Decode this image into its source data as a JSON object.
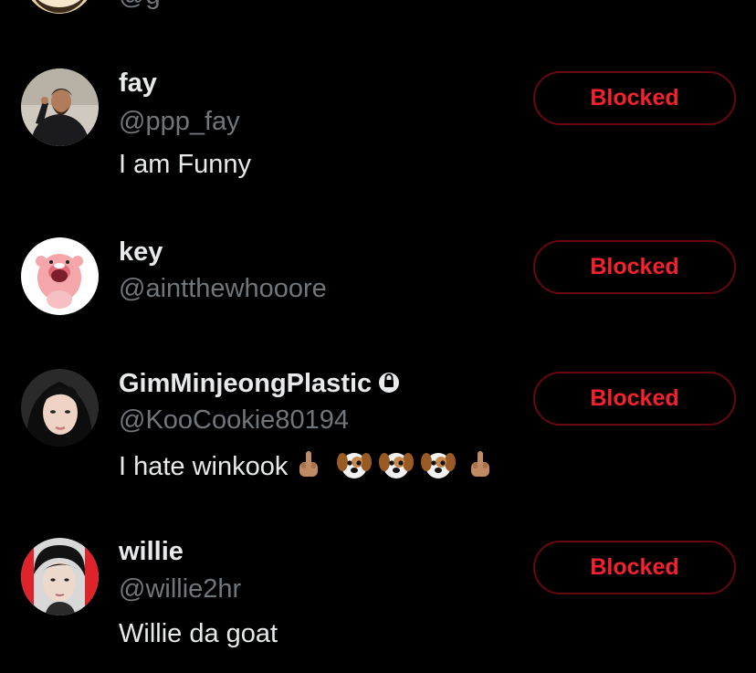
{
  "users": [
    {
      "name": "fay",
      "handle": "@ppp_fay",
      "bio": "I am Funny",
      "button_label": "Blocked"
    },
    {
      "name": "key",
      "handle": "@aintthewhooore",
      "bio": "",
      "button_label": "Blocked"
    },
    {
      "name": "GimMinjeongPlastic",
      "handle": "@KooCookie80194",
      "bio": "I hate winkook",
      "protected": true,
      "bio_emojis": [
        "middle-finger-emoji",
        "dog-face-emoji",
        "dog-face-emoji",
        "dog-face-emoji",
        "middle-finger-emoji"
      ],
      "button_label": "Blocked"
    },
    {
      "name": "willie",
      "handle": "@willie2hr",
      "bio": "Willie da goat",
      "button_label": "Blocked"
    }
  ],
  "colors": {
    "background": "#000000",
    "name": "#e7e9ea",
    "handle": "#71767b",
    "blocked_text": "#f4212e",
    "blocked_border": "#67070f"
  }
}
